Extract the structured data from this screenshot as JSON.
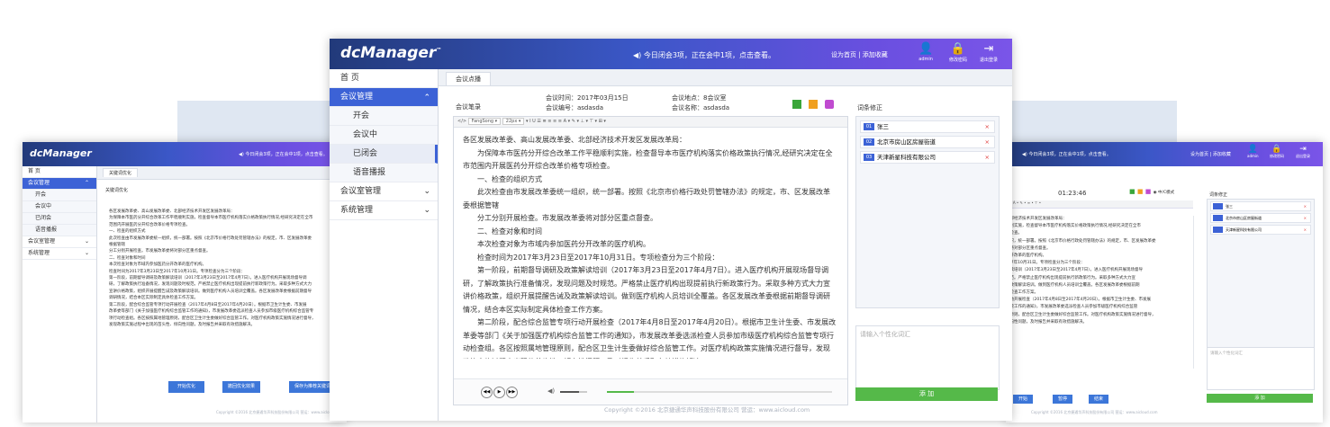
{
  "app": {
    "logo": "dcManager",
    "notice": "今日闭会3项，正在会中1项，点击查看。",
    "header_links": "设为首页 | 添加收藏",
    "user": "admin",
    "change_password": "修改密码",
    "logout": "退出登录"
  },
  "sidebar": {
    "home": "首 页",
    "meeting_manage": "会议管理",
    "sub_open": "开会",
    "sub_in_meeting": "会议中",
    "sub_closed": "已闭会",
    "sub_voice": "语音播报",
    "room_manage": "会议室管理",
    "system_manage": "系统管理"
  },
  "main": {
    "tab": "会议点播",
    "record_label": "会议笔录",
    "time": "会议时间：2017年03月15日",
    "place": "会议地点：8会议室",
    "number": "会议编号：asdasda",
    "name": "会议名称：asdasda",
    "toolbar_font": "FangSong",
    "toolbar_size": "22px",
    "doc_lines": [
      "各区发展改革委、高山发展改革委、北部经济技术开发区发展改革局：",
      "为保障本市医药分开综合改革工作平稳顺利实施，检查督导本市医疗机构落实价格政策执行情况,经研究决定在全市范围内开展医药分开综合改革价格专项检查。",
      "一、检查的组织方式",
      "此次检查由市发展改革委统一组织，统一部署。按照《北京市价格行政处罚管辖办法》的规定，市、区发展改革委根据管辖",
      "分工分别开展检查。市发展改革委将对部分区重点督查。",
      "二、检查对象和时间",
      "本次检查对象为市域内参加医药分开改革的医疗机构。",
      "检查时间为2017年3月23日至2017年10月31日。专项检查分为三个阶段：",
      "第一阶段，前期督导调研及政策解读培训（2017年3月23日至2017年4月7日）。进入医疗机构开展现场督导调研，了解政策执行准备情况，发现问题及时规范。严格禁止医疗机构出现提前执行新政策行为。采取多种方式大力宣讲价格政策，组织开展提醒告诫及政策解读培训。做到医疗机构人员培训全覆盖。各区发展改革委根据前期督导调研情况，结合本区实际制定具体检查工作方案。",
      "第二阶段，配合综合监管专项行动开展检查（2017年4月8日至2017年4月20日）。根据市卫生计生委、市发展改革委等部门《关于加强医疗机构综合监管工作的通知》，市发展改革委选派检查人员参加市级医疗机构综合监管专项行动检查组。各区按照属地管理原则，配合区卫生计生委做好综合监管工作。对医疗机构政策实施情况进行督导，发现政策实施过程中出现的苗头性、倾向性问题，及时报告并采取有效措施解决。"
    ],
    "correction_title": "词条修正",
    "corrections": [
      "张三",
      "北京市房山区房屋街道",
      "天津新星科技有限公司"
    ],
    "correction_nums": [
      "01",
      "02",
      "03"
    ],
    "input_placeholder": "请输入个性化词汇",
    "add_button": "添 加",
    "footer": "Copyright ©2016 北京捷通华声科技股份有限公司  营运：www.aicloud.com"
  },
  "left_win": {
    "tab": "关键词优化",
    "title": "关键词优化",
    "doc_lines": [
      "各区发展改革委、高山发展改革委、北部经济技术开发区发展改革局：",
      "为保障本市医药分开综合改革工作平稳顺利实施，检查督导本市医疗机构落实价格政策执行情况,经研究决定在全市",
      "范围内开展医药分开综合改革价格专项检查。",
      "一、检查的组织方式",
      "此次检查由市发展改革委统一组织，统一部署。按照《北京市价格行政处罚管辖办法》的规定，市、区发展改革委",
      "根据管辖",
      "分工分别开展检查。市发展改革委将对部分区重点督查。",
      "二、检查对象和时间",
      "本次检查对象为市域内参加医药分开改革的医疗机构。",
      "检查时间为2017年3月23日至2017年10月31日。专项检查分为三个阶段：",
      "第一阶段，前期督导调研及政策解读培训（2017年3月23日至2017年4月7日）。进入医疗机构开展现场督导调",
      "研，了解政策执行准备情况，发现问题及时规范。严格禁止医疗机构出现提前执行新政策行为。采取多种方式大力",
      "宣讲价格政策，组织开展提醒告诫及政策解读培训。做到医疗机构人员培训全覆盖。各区发展改革委根据前期督导",
      "调研情况，结合本区实际制定具体检查工作方案。",
      "第二阶段，配合综合监管专项行动开展检查（2017年4月8日至2017年4月20日）。根据市卫生计生委、市发展",
      "改革委等部门《关于加强医疗机构综合监管工作的通知》，市发展改革委选派检查人员参加市级医疗机构综合监管专",
      "项行动检查组。各区按照属地管理原则，配合区卫生计生委做好综合监管工作。对医疗机构政策实施情况进行督导，",
      "发现政策实施过程中出现的苗头性、倾向性问题，及时报告并采取有效措施解决。"
    ],
    "buttons": [
      "开始优化",
      "撤回优化效果",
      "保存为推荐关键词"
    ]
  },
  "right_win": {
    "timer": "01:23:46",
    "mode": "◉ 中/C模式",
    "correction_title": "词条修正",
    "corrections": [
      "张三",
      "北京市房山区房屋街道",
      "天津新星科技有限公司"
    ],
    "doc_lines": [
      "北部经济技术开发区发展改革局：",
      "顺利实施，检查督导本市医疗机构落实价格政策执行情况,经研究决定在全市",
      "项检查。",
      "组织，统一部署。按照《北京市价格行政处罚管辖办法》的规定，市、区发展改革委",
      "委将对部分区重点督查。",
      "分开改革的医疗机构。",
      "017年10月31日。专项检查分为三个阶段：",
      "解读培训（2017年3月23日至2017年4月7日）。进入医疗机构开展现场督导",
      "规范。严格禁止医疗机构出现提前执行新政策行为。采取多种方式大力宣",
      "及政策解读培训。做到医疗机构人员培训全覆盖。各区发展改革委根据前期",
      "体检查工作方案。",
      "行动开展检查（2017年4月8日至2017年4月20日）。根据市卫生计生委、市发展",
      "监管工作的通知》，市发展改革委选派检查人员参加市级医疗机构综合监管",
      "理原则，配合区卫生计生委做好综合监管工作。对医疗机构政策实施情况进行督导，",
      "倾向性问题，及时报告并采取有效措施解决。"
    ],
    "input_placeholder": "请输入个性化词汇",
    "buttons": [
      "开始",
      "暂停",
      "结束"
    ]
  },
  "colors": {
    "header_start": "#223a7a",
    "header_end": "#7a55e8",
    "accent": "#3c62d6",
    "add_green": "#55b949",
    "delete_red": "#e03b3b"
  }
}
